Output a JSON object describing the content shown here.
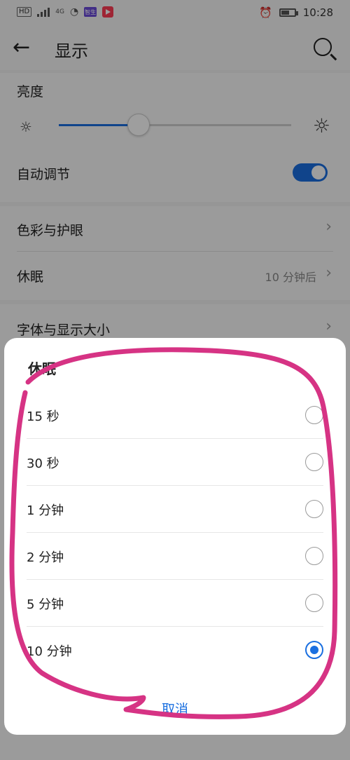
{
  "status_bar": {
    "network_labels": [
      "HD",
      "4G"
    ],
    "app_badge": "智生",
    "time": "10:28",
    "battery_level": 0.6
  },
  "app_bar": {
    "title": "显示"
  },
  "settings": {
    "brightness_label": "亮度",
    "brightness_level": 0.34,
    "auto_adjust_label": "自动调节",
    "auto_adjust_on": true,
    "color_eye_label": "色彩与护眼",
    "sleep_label": "休眠",
    "sleep_value": "10 分钟后",
    "font_size_label": "字体与显示大小"
  },
  "dialog": {
    "title": "休眠",
    "options": [
      {
        "label": "15 秒",
        "selected": false
      },
      {
        "label": "30 秒",
        "selected": false
      },
      {
        "label": "1 分钟",
        "selected": false
      },
      {
        "label": "2 分钟",
        "selected": false
      },
      {
        "label": "5 分钟",
        "selected": false
      },
      {
        "label": "10 分钟",
        "selected": true
      }
    ],
    "cancel_label": "取消"
  },
  "colors": {
    "accent": "#1a6fe0",
    "annotation": "#d63384"
  }
}
